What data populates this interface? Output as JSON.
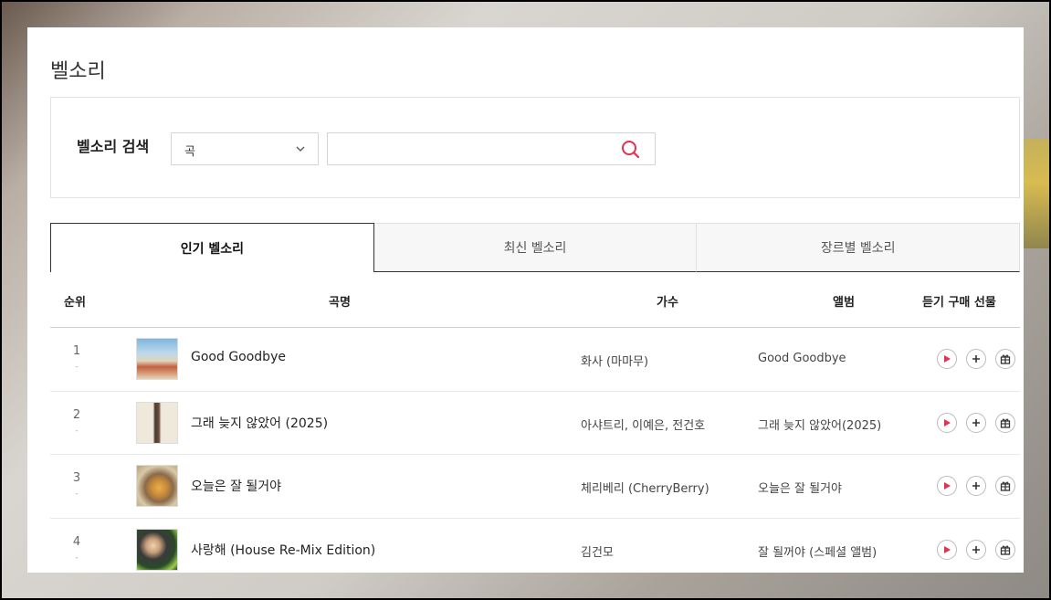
{
  "page": {
    "title": "벨소리"
  },
  "search": {
    "label": "벨소리 검색",
    "select_value": "곡",
    "input_value": "",
    "placeholder": ""
  },
  "tabs": [
    {
      "label": "인기 벨소리",
      "active": true
    },
    {
      "label": "최신 벨소리",
      "active": false
    },
    {
      "label": "장르별 벨소리",
      "active": false
    }
  ],
  "table": {
    "headers": {
      "rank": "순위",
      "song": "곡명",
      "artist": "가수",
      "album": "앨범",
      "actions": "듣기 구매 선물"
    },
    "rows": [
      {
        "rank": "1",
        "change": "-",
        "song": "Good Goodbye",
        "artist": "화사 (마마무)",
        "album": "Good Goodbye"
      },
      {
        "rank": "2",
        "change": "-",
        "song": "그래 늦지 않았어 (2025)",
        "artist": "아샤트리, 이예은, 전건호",
        "album": "그래 늦지 않았어(2025)"
      },
      {
        "rank": "3",
        "change": "-",
        "song": "오늘은 잘 될거야",
        "artist": "체리베리 (CherryBerry)",
        "album": "오늘은 잘 될거야"
      },
      {
        "rank": "4",
        "change": "-",
        "song": "사랑해 (House Re-Mix Edition)",
        "artist": "김건모",
        "album": "잘 될꺼야 (스페셜 앨범)"
      }
    ]
  },
  "colors": {
    "accent": "#e5304f",
    "border": "#e2e2e2"
  },
  "icons": {
    "search": "search-icon",
    "dropdown": "chevron-down-icon",
    "play": "play-icon",
    "add": "plus-icon",
    "gift": "gift-icon"
  }
}
